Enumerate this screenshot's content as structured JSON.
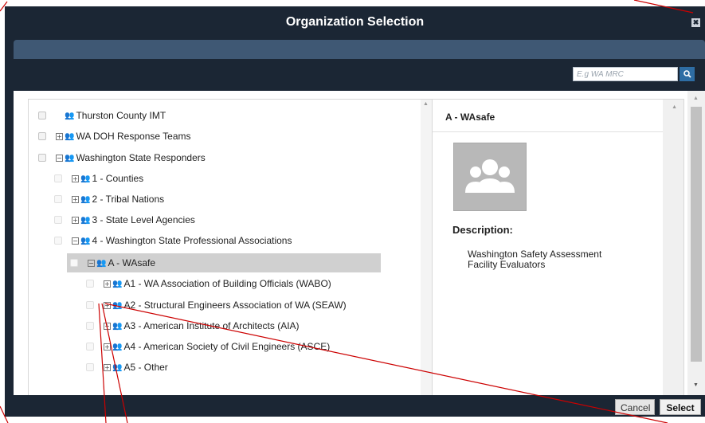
{
  "dialog": {
    "title": "Organization Selection",
    "close_glyph": "✖"
  },
  "search": {
    "placeholder": "E.g WA MRC",
    "button_glyph": "🔍"
  },
  "tree": {
    "items": [
      {
        "label": "Thurston County IMT"
      },
      {
        "label": "WA DOH Response Teams"
      },
      {
        "label": "Washington State Responders"
      },
      {
        "label": "1 - Counties"
      },
      {
        "label": "2 - Tribal Nations"
      },
      {
        "label": "3 - State Level Agencies"
      },
      {
        "label": "4 - Washington State Professional Associations"
      },
      {
        "label": "A - WAsafe"
      },
      {
        "label": "A1 - WA Association of Building Officials (WABO)"
      },
      {
        "label": "A2 - Structural Engineers Association of WA (SEAW)"
      },
      {
        "label": "A3 - American Institute of Architects (AIA)"
      },
      {
        "label": "A4 - American Society of Civil Engineers (ASCE)"
      },
      {
        "label": "A5 - Other"
      }
    ],
    "expand_glyph": "⊞",
    "collapse_glyph": "⊟",
    "group_icon": "group-icon"
  },
  "detail": {
    "title": "A - WAsafe",
    "description_label": "Description:",
    "description": "Washington Safety Assessment Facility Evaluators"
  },
  "footer": {
    "cancel_label": "Cancel",
    "select_label": "Select"
  },
  "colors": {
    "header_bg": "#1b2634",
    "subheader_bg": "#3f5874",
    "search_button": "#2e6da4",
    "annotation_line": "#cc0000"
  }
}
